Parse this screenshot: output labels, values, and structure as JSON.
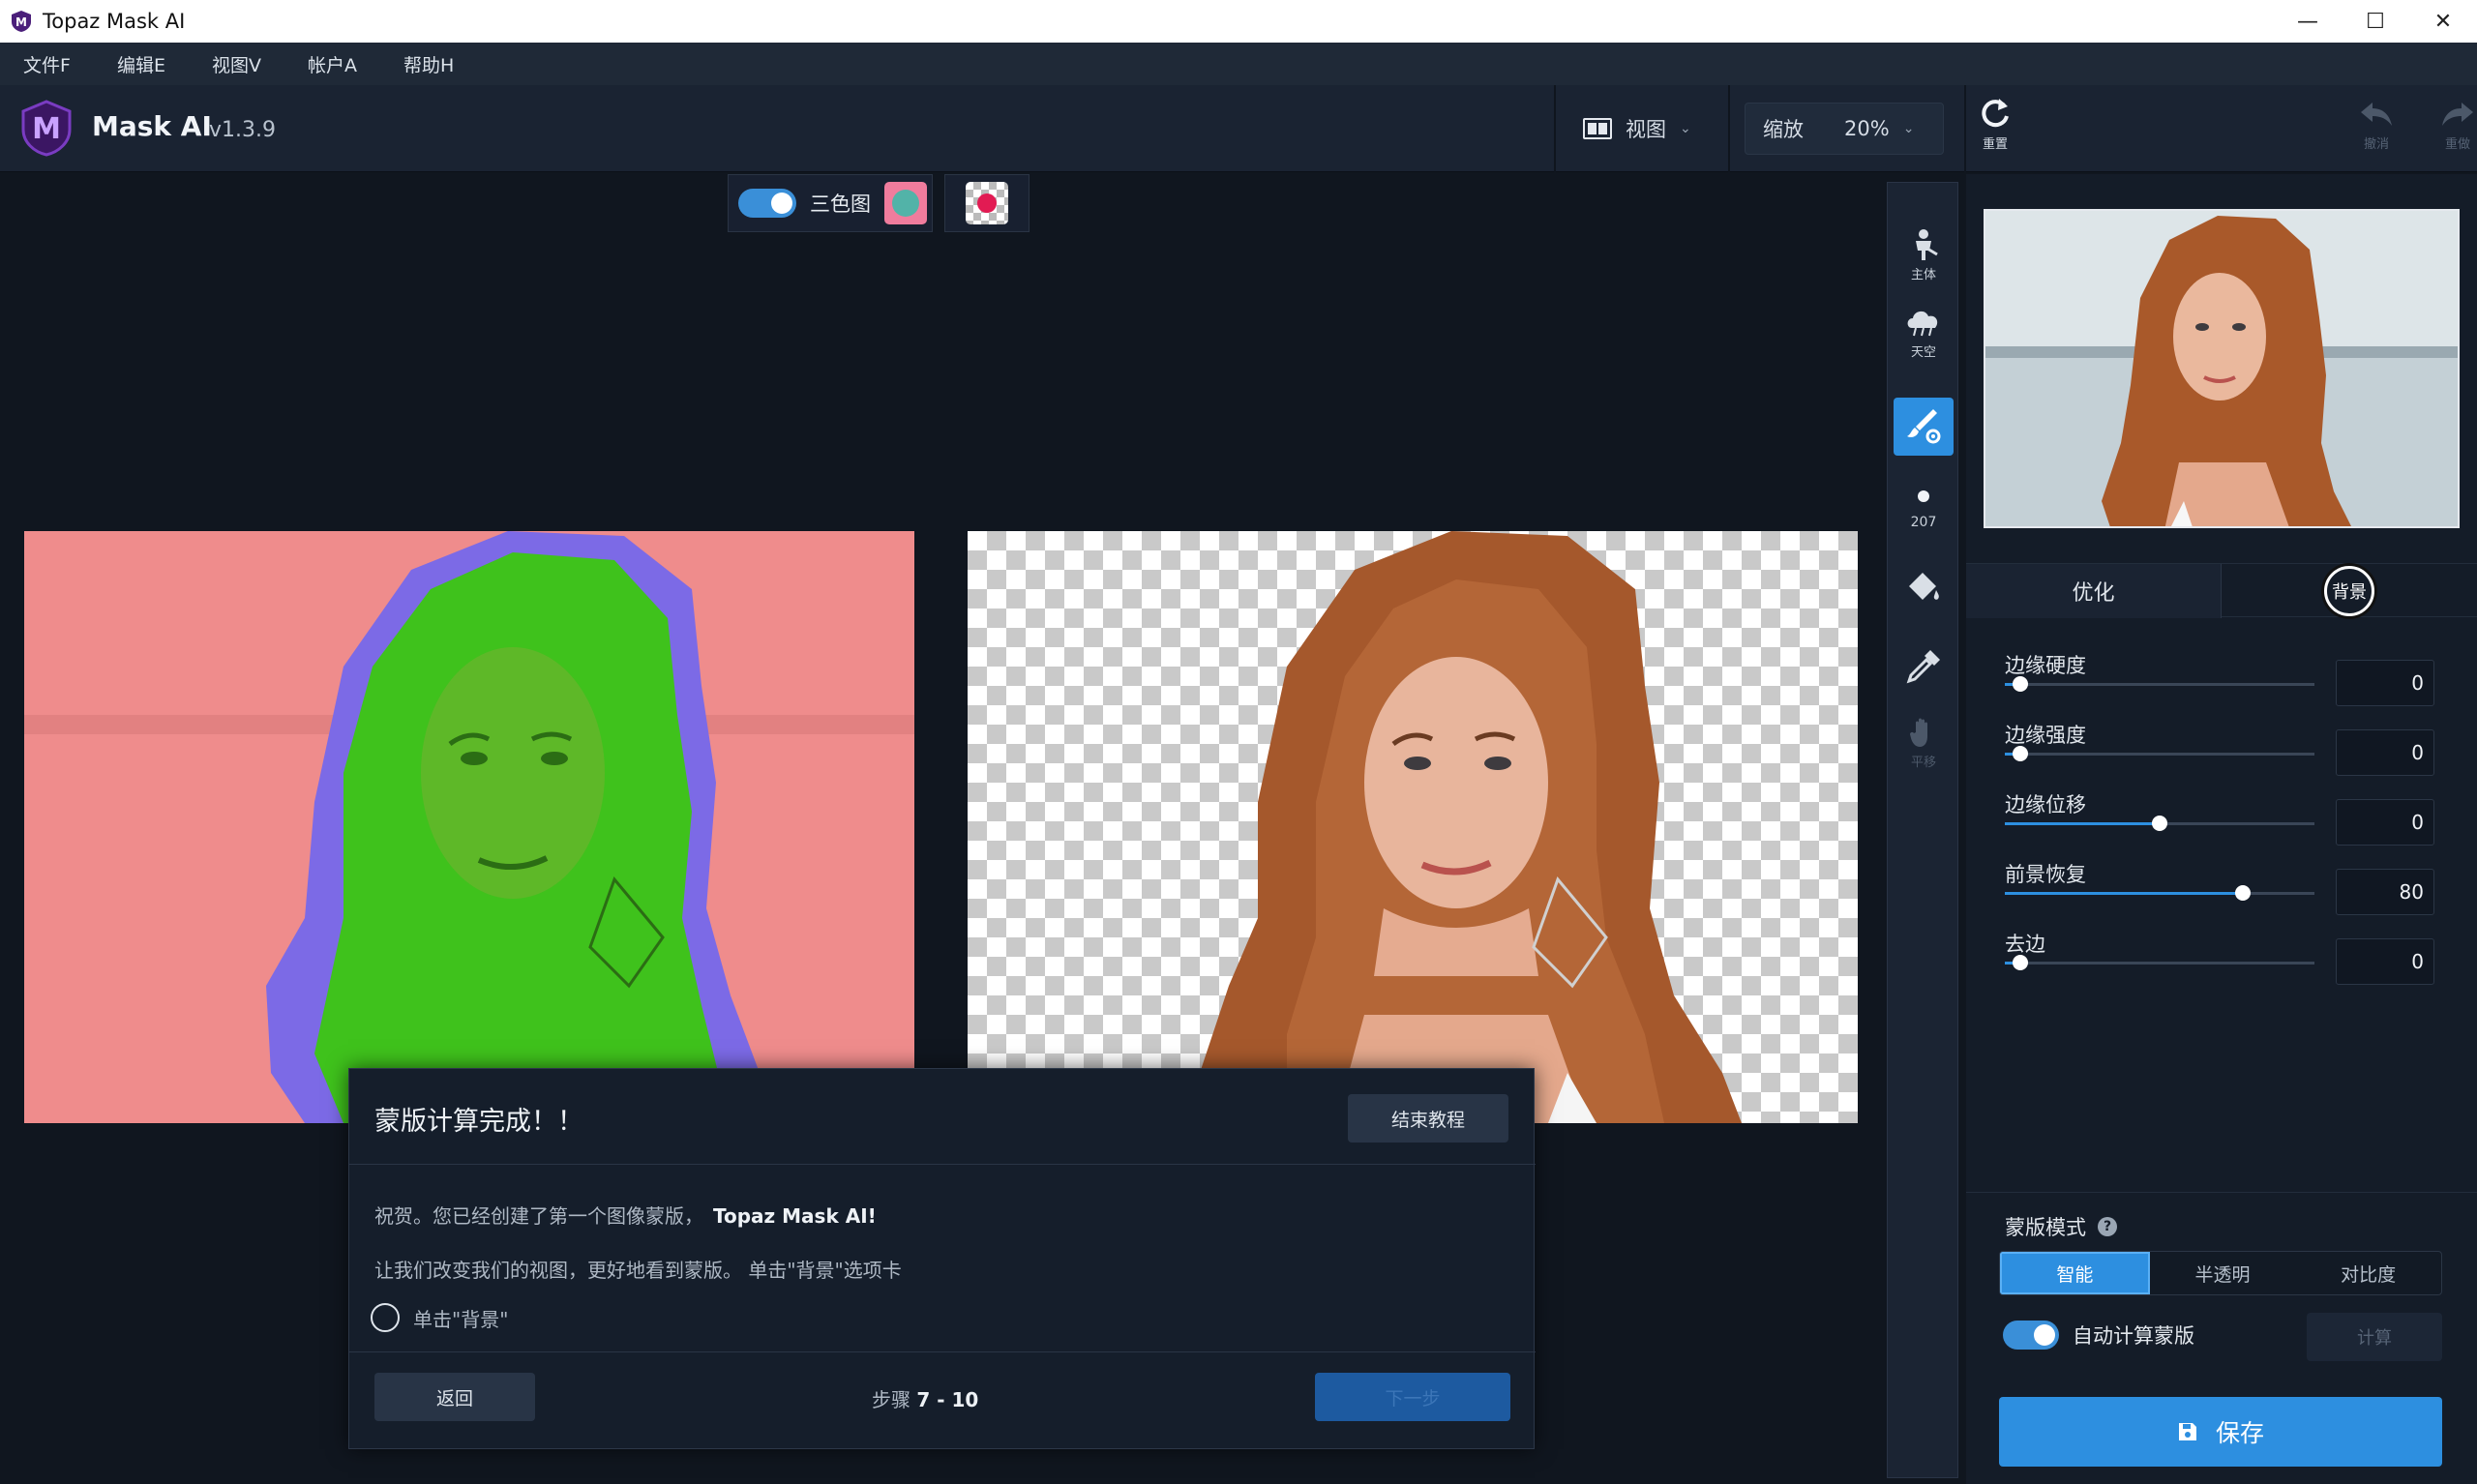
{
  "window": {
    "title": "Topaz Mask AI",
    "controls": [
      "—",
      "☐",
      "✕"
    ]
  },
  "menu": [
    {
      "label": "文件F"
    },
    {
      "label": "编辑E"
    },
    {
      "label": "视图V"
    },
    {
      "label": "帐户A"
    },
    {
      "label": "帮助H"
    }
  ],
  "header": {
    "product": "Mask AI",
    "version": "v1.3.9",
    "view_label": "视图",
    "zoom_label": "缩放",
    "zoom_value": "20%",
    "reset_label": "重置",
    "undo_label": "撤消",
    "redo_label": "重做"
  },
  "canvas": {
    "trimap_label": "三色图",
    "trimap_on": true
  },
  "tools": [
    {
      "name": "subject",
      "label": "主体",
      "icon": "person-icon"
    },
    {
      "name": "sky",
      "label": "天空",
      "icon": "cloud-icon"
    },
    {
      "name": "brush",
      "label": "",
      "icon": "brush-gear-icon",
      "active": true
    },
    {
      "name": "brush-size",
      "label": "207",
      "icon": "dot-icon"
    },
    {
      "name": "fill",
      "label": "",
      "icon": "paint-bucket-icon"
    },
    {
      "name": "eyedropper",
      "label": "",
      "icon": "eyedropper-icon"
    },
    {
      "name": "pan",
      "label": "平移",
      "icon": "hand-icon"
    }
  ],
  "panel": {
    "tabs": [
      "优化",
      "背景"
    ],
    "sliders": [
      {
        "label": "边缘硬度",
        "value": "0",
        "fraction": 0.05
      },
      {
        "label": "边缘强度",
        "value": "0",
        "fraction": 0.05
      },
      {
        "label": "边缘位移",
        "value": "0",
        "fraction": 0.5
      },
      {
        "label": "前景恢复",
        "value": "80",
        "fraction": 0.77
      },
      {
        "label": "去边",
        "value": "0",
        "fraction": 0.05
      }
    ],
    "mask_mode_label": "蒙版模式",
    "mask_modes": [
      "智能",
      "半透明",
      "对比度"
    ],
    "mask_mode_selected": 0,
    "auto_compute_label": "自动计算蒙版",
    "auto_compute_on": true,
    "compute_label": "计算",
    "save_label": "保存"
  },
  "dialog": {
    "title": "蒙版计算完成！！",
    "end_label": "结束教程",
    "line1": "祝贺。您已经创建了第一个图像蒙版，",
    "line1_bold": "Topaz Mask AI!",
    "line2": "让我们改变我们的视图，更好地看到蒙版。 单击\"背景\"选项卡",
    "task": "单击\"背景\"",
    "back_label": "返回",
    "step_prefix": "步骤",
    "step_value": "7 - 10",
    "next_label": "下一步"
  },
  "colors": {
    "accent": "#2d8fe0",
    "bg": "#10161f",
    "background_overlay": "#ef8888",
    "foreground_overlay": "#35c21e",
    "edge_overlay": "#7d6be8"
  }
}
